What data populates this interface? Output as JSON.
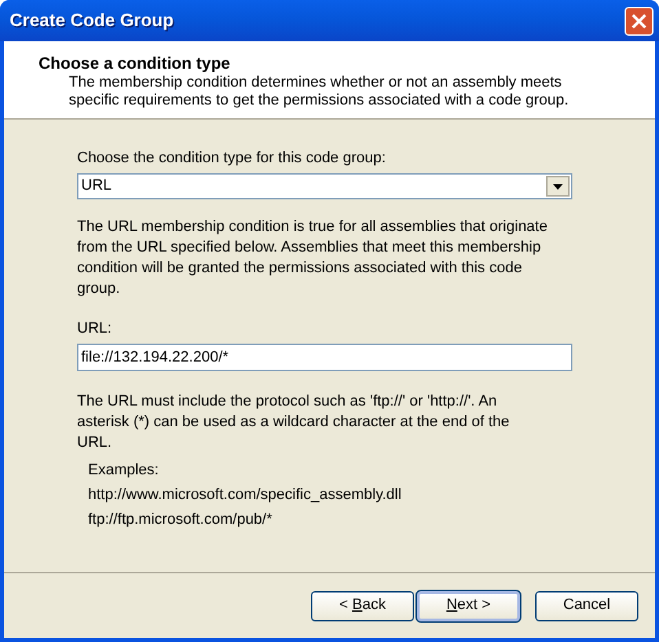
{
  "window": {
    "title": "Create Code Group"
  },
  "header": {
    "title": "Choose a condition type",
    "description": "The membership condition determines whether or not an assembly meets specific requirements to get the permissions associated with a code group."
  },
  "condition": {
    "label": "Choose the condition type for this code group:",
    "value": "URL"
  },
  "condition_description": "The URL membership condition is true for all assemblies that originate from the URL specified below.  Assemblies that meet this membership condition will be granted the permissions associated with this code group.",
  "url": {
    "label": "URL:",
    "value": "file://132.194.22.200/*"
  },
  "help": "The URL must include the protocol such as 'ftp://' or 'http://'.  An asterisk (*) can be used as a wildcard character at the end of the URL.",
  "examples": {
    "label": "Examples:",
    "items": [
      "http://www.microsoft.com/specific_assembly.dll",
      "ftp://ftp.microsoft.com/pub/*"
    ]
  },
  "buttons": [
    {
      "before": "< ",
      "key": "B",
      "after": "ack",
      "kind": "normal",
      "default": false
    },
    {
      "key": "N",
      "after": "ext >",
      "kind": "normal",
      "default": true
    },
    {
      "before": "Cancel",
      "kind": "spaced",
      "default": false
    }
  ]
}
